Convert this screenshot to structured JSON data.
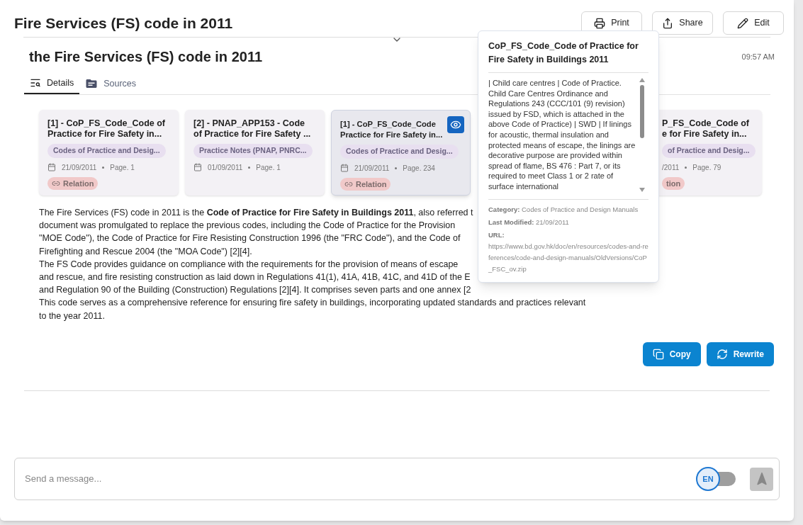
{
  "header": {
    "title": "Fire Services (FS) code in 2011",
    "buttons": [
      {
        "label": "Print",
        "kind": "print"
      },
      {
        "label": "Share",
        "kind": "share"
      },
      {
        "label": "Edit",
        "kind": "edit"
      }
    ]
  },
  "message": {
    "title": "the Fire Services (FS) code in 2011",
    "time": "09:57 AM",
    "tabs": [
      {
        "label": "Details",
        "kind": "details",
        "selected": true
      },
      {
        "label": "Sources",
        "kind": "sources",
        "selected": false
      }
    ],
    "sources": [
      {
        "kind": "full",
        "title": "[1] - CoP_FS_Code_Code of\nPractice for Fire Safety in...",
        "category": "Codes of Practice and Desig...",
        "date": "21/09/2011",
        "page": "Page. 1",
        "relation": "Relation",
        "selected": false
      },
      {
        "kind": "full",
        "title": "[2] - PNAP_APP153 - Code\nof Practice for Fire Safety ...",
        "category": "Practice Notes (PNAP, PNRC...",
        "date": "01/09/2011",
        "page": "Page. 1",
        "selected": false
      },
      {
        "kind": "full",
        "title": "[1] - CoP_FS_Code_Code\nPractice for Fire Safety in...",
        "category": "Codes of Practice and Desig...",
        "date": "21/09/2011",
        "page": "Page. 234",
        "relation": "Relation",
        "selected": true
      },
      {
        "kind": "hidden"
      },
      {
        "kind": "partial",
        "title": "P_FS_Code_Code of\ne for Fire Safety in...",
        "category": "of Practice and Desig...",
        "date": "/2011",
        "page": "Page. 79",
        "relation": "tion",
        "selected": false
      }
    ],
    "answer_lines": [
      "The Fire Services (FS) code in 2011 is the **Code of Practice for Fire Safety in Buildings 2011**, also referred t",
      "document was promulgated to replace the previous codes, including the Code of Practice for the Provision",
      "\"MOE Code\"), the Code of Practice for Fire Resisting Construction 1996 (the \"FRC Code\"), and the Code of",
      "Firefighting and Rescue 2004 (the \"MOA Code\") [2][4].",
      "The FS Code provides guidance on compliance with the requirements for the provision of means of escape",
      "and rescue, and fire resisting construction as laid down in Regulations 41(1), 41A, 41B, 41C, and 41D of the E",
      "and Regulation 90 of the Building (Construction) Regulations [2][4]. It comprises seven parts and one annex [2",
      "This code serves as a comprehensive reference for ensuring fire safety in buildings, incorporating updated standards and practices relevant",
      "to the year 2011."
    ],
    "actions": [
      {
        "label": "Copy",
        "kind": "copy"
      },
      {
        "label": "Rewrite",
        "kind": "rewrite"
      }
    ]
  },
  "popover": {
    "title": "CoP_FS_Code_Code of Practice for Fire Safety in Buildings 2011",
    "excerpt": "| Child care centres | Code of Practice. Child Care Centres Ordinance and Regulations 243 (CCC/101 (9) revision) issued by FSD, which is attached in the above Code of Practice) | SWD | If linings for acoustic, thermal insulation and protected means of escape, the linings are decorative purpose are provided within spread of flame, BS 476 : Part 7, or its required to meet Class 1 or 2 rate of surface international",
    "fields": [
      {
        "label": "Category:",
        "value": "Codes of Practice and Design Manuals",
        "kind": "inline"
      },
      {
        "label": "Last Modified:",
        "value": "21/09/2011",
        "kind": "inline"
      },
      {
        "label": "URL:",
        "value": "https://www.bd.gov.hk/doc/en/resources/codes-and-references/code-and-design-manuals/OldVersions/CoP_FSC_ov.zip",
        "kind": "block"
      }
    ]
  },
  "composer": {
    "placeholder": "Send a message...",
    "language": "EN",
    "language_on": false
  }
}
